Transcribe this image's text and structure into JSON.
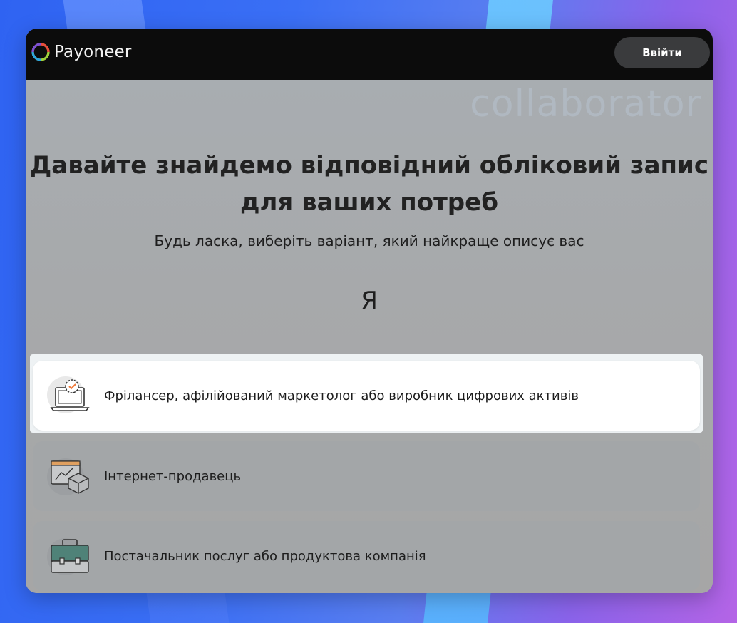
{
  "brand": {
    "name": "Payoneer"
  },
  "header": {
    "login_label": "Ввійти"
  },
  "watermark": "collaborator",
  "main": {
    "title_line1": "Давайте знайдемо відповідний обліковий запис",
    "title_line2": "для ваших потреб",
    "subtitle": "Будь ласка, виберіть варіант, який найкраще описує вас",
    "prefix": "Я"
  },
  "options": [
    {
      "label": "Фрілансер, афілійований маркетолог або виробник цифрових активів",
      "icon": "laptop-badge-icon",
      "selected": true
    },
    {
      "label": "Інтернет-продавець",
      "icon": "store-box-icon",
      "selected": false
    },
    {
      "label": "Постачальник послуг або продуктова компанія",
      "icon": "briefcase-icon",
      "selected": false
    }
  ],
  "colors": {
    "topbar": "#0c0c0c",
    "login_bg": "#3a3b3d",
    "page_bg": "#a9abad",
    "accent": "#f07a3a"
  }
}
